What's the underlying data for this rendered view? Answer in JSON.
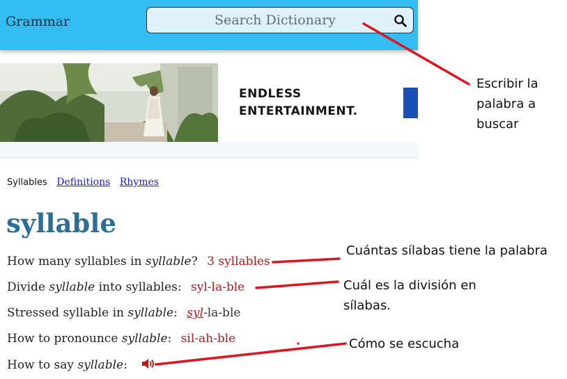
{
  "header": {
    "brand": "Grammar",
    "search_placeholder": "Search Dictionary",
    "search_icon": "search-icon"
  },
  "ad": {
    "line1": "ENDLESS",
    "line2": "ENTERTAINMENT."
  },
  "subnav": {
    "current": "Syllables",
    "links": [
      "Definitions",
      "Rhymes"
    ]
  },
  "entry": {
    "word": "syllable",
    "q1": {
      "prefix": "How many syllables in ",
      "word": "syllable",
      "suffix": "?",
      "answer": "3 syllables"
    },
    "q2": {
      "prefix": "Divide ",
      "word": "syllable",
      "suffix": " into syllables:",
      "answer": "syl-la-ble"
    },
    "q3": {
      "prefix": "Stressed syllable in ",
      "word": "syllable",
      "suffix": ":",
      "stressed": "syl",
      "rest": "-la-ble"
    },
    "q4": {
      "prefix": "How to pronounce ",
      "word": "syllable",
      "suffix": ":",
      "answer": "sil-ah-ble"
    },
    "q5": {
      "prefix": "How to say ",
      "word": "syllable",
      "suffix": ":",
      "icon": "speaker-icon"
    }
  },
  "annotations": {
    "search_note": [
      "Escribir la",
      "palabra a",
      "buscar"
    ],
    "syllable_count_note": "Cuántas sílabas tiene la palabra",
    "division_note": [
      "Cuál es la división en",
      "sílabas."
    ],
    "sound_note": "Cómo se escucha",
    "arrow_color": "#e0141c"
  }
}
